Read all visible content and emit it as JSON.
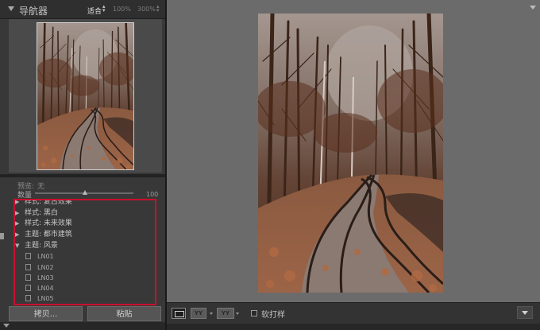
{
  "navigator": {
    "title": "导航器",
    "zoom_fit": "适合",
    "zoom_100": "100%",
    "zoom_300": "300%"
  },
  "preview_panel": {
    "preview_label": "预览:",
    "preview_value": "无",
    "amount_label": "数量",
    "amount_value": "100",
    "amount_level": 0.6
  },
  "presets": [
    {
      "label": "样式: 复古效果",
      "expanded": false
    },
    {
      "label": "样式: 黑白",
      "expanded": false
    },
    {
      "label": "样式: 未来效果",
      "expanded": false
    },
    {
      "label": "主题: 都市建筑",
      "expanded": false
    },
    {
      "label": "主题: 风景",
      "expanded": true,
      "children": [
        "LN01",
        "LN02",
        "LN03",
        "LN04",
        "LN05"
      ]
    }
  ],
  "buttons": {
    "copy": "拷贝...",
    "paste": "粘贴"
  },
  "toolbar": {
    "ba_label": "YY",
    "yy_label": "YY",
    "soft_proof": "软打样"
  },
  "colors": {
    "highlight_box": "#c8102e",
    "panel_bg": "#383838",
    "main_bg": "#6b6b6b"
  }
}
